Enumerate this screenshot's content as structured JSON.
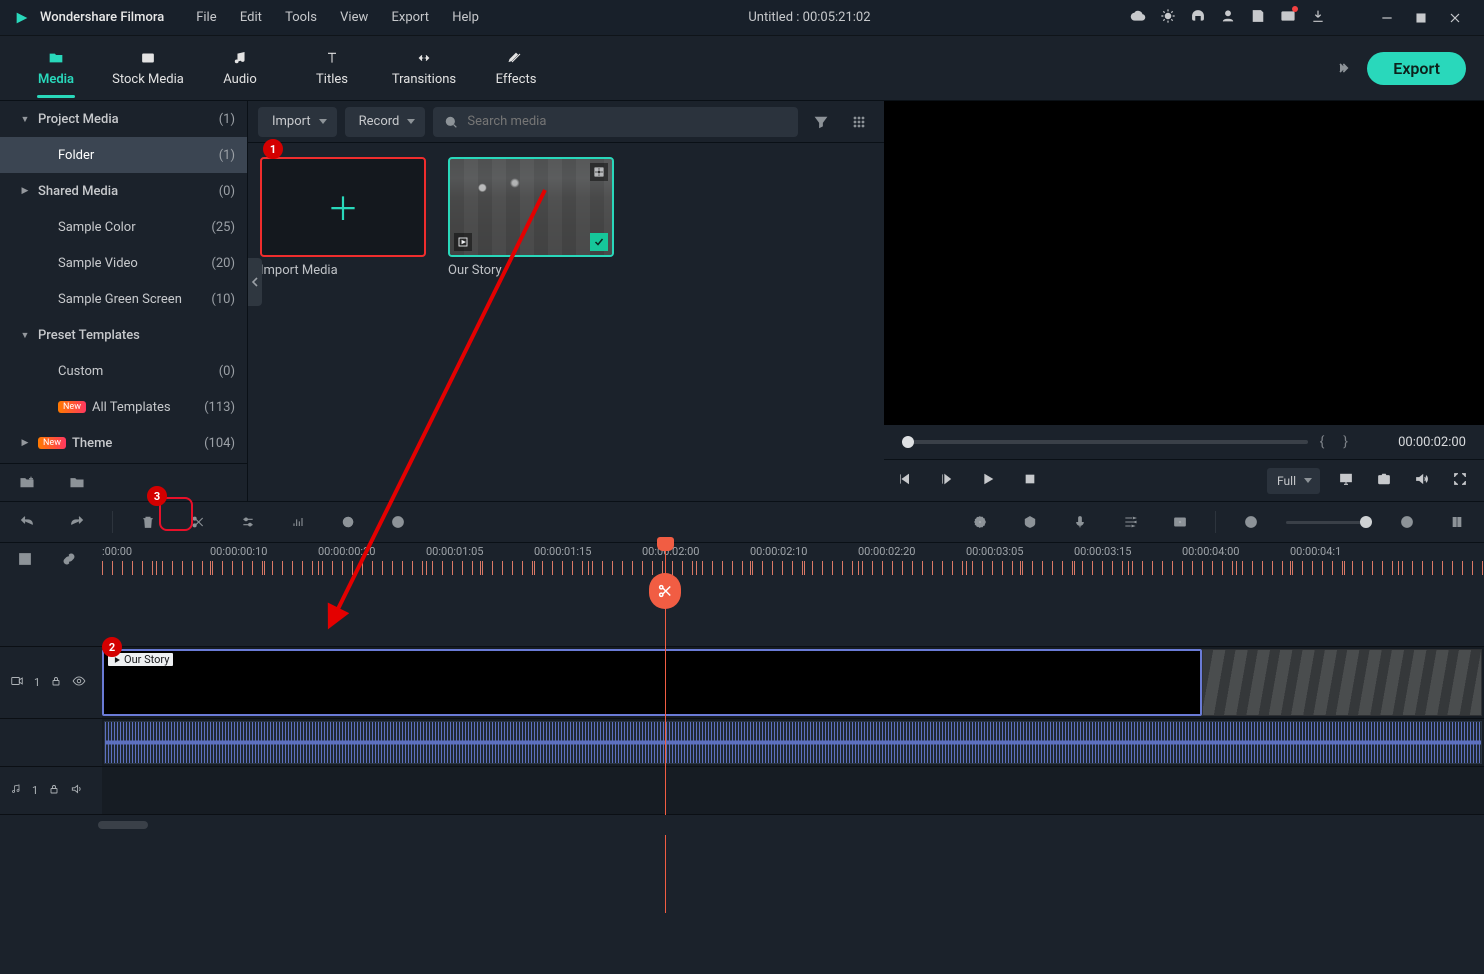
{
  "app_name": "Wondershare Filmora",
  "menu": [
    "File",
    "Edit",
    "Tools",
    "View",
    "Export",
    "Help"
  ],
  "title_center": "Untitled : 00:05:21:02",
  "tabs": [
    "Media",
    "Stock Media",
    "Audio",
    "Titles",
    "Transitions",
    "Effects"
  ],
  "active_tab": "Media",
  "export_btn": "Export",
  "sidebar": [
    {
      "type": "parent",
      "arrow": "▼",
      "label": "Project Media",
      "count": "(1)"
    },
    {
      "type": "child",
      "label": "Folder",
      "count": "(1)",
      "selected": true
    },
    {
      "type": "parent",
      "arrow": "▶",
      "label": "Shared Media",
      "count": "(0)"
    },
    {
      "type": "child",
      "label": "Sample Color",
      "count": "(25)"
    },
    {
      "type": "child",
      "label": "Sample Video",
      "count": "(20)"
    },
    {
      "type": "child",
      "label": "Sample Green Screen",
      "count": "(10)"
    },
    {
      "type": "parent",
      "arrow": "▼",
      "label": "Preset Templates",
      "count": ""
    },
    {
      "type": "child",
      "label": "Custom",
      "count": "(0)"
    },
    {
      "type": "child",
      "label": "All Templates",
      "count": "(113)",
      "new": true
    },
    {
      "type": "parent",
      "arrow": "▶",
      "label": "Theme",
      "count": "(104)",
      "new": true
    }
  ],
  "browser": {
    "import_btn": "Import",
    "record_btn": "Record",
    "search_placeholder": "Search media",
    "import_card": "Import Media",
    "clip_card": "Our Story"
  },
  "preview": {
    "time": "00:00:02:00",
    "quality": "Full"
  },
  "ruler_labels": [
    ":00:00",
    "00:00:00:10",
    "00:00:00:20",
    "00:00:01:05",
    "00:00:01:15",
    "00:00:02:00",
    "00:00:02:10",
    "00:00:02:20",
    "00:00:03:05",
    "00:00:03:15",
    "00:00:04:00",
    "00:00:04:1"
  ],
  "timeline_clip": "Our Story",
  "video_track_label": "1",
  "audio_track_label": "1"
}
